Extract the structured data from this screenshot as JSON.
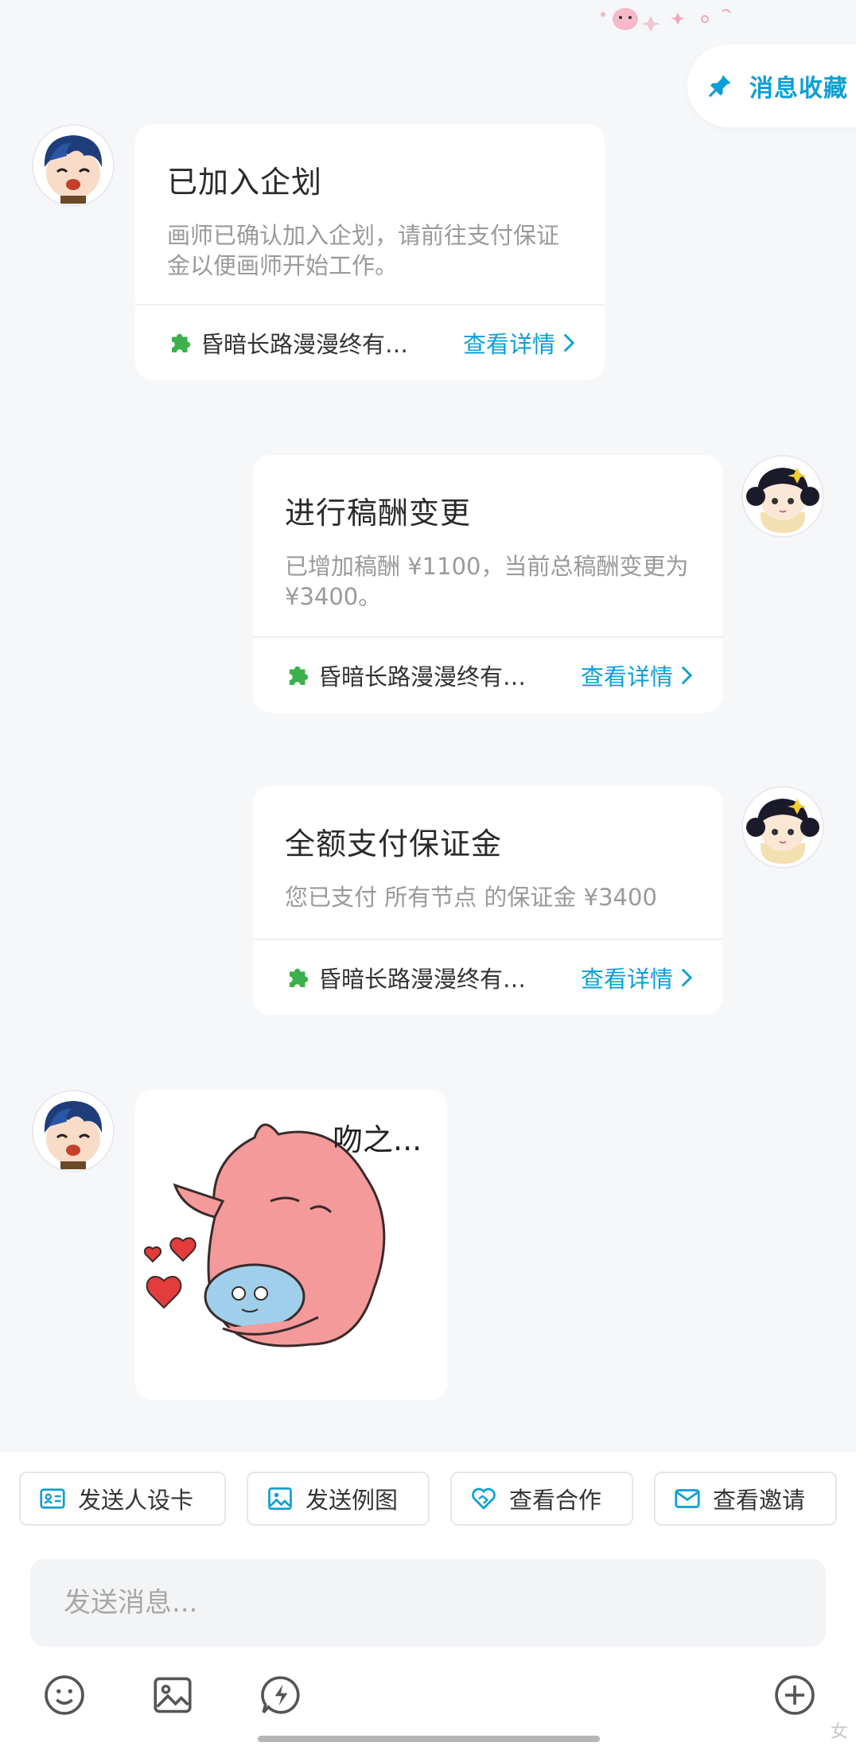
{
  "header": {
    "favorites_label": "消息收藏"
  },
  "messages": [
    {
      "title": "已加入企划",
      "desc": "画师已确认加入企划，请前往支付保证金以便画师开始工作。",
      "project": "昏暗长路漫漫终有…",
      "link": "查看详情"
    },
    {
      "title": "进行稿酬变更",
      "desc": "已增加稿酬 ¥1100，当前总稿酬变更为 ¥3400。",
      "project": "昏暗长路漫漫终有…",
      "link": "查看详情"
    },
    {
      "title": "全额支付保证金",
      "desc": "您已支付 所有节点 的保证金 ¥3400",
      "project": "昏暗长路漫漫终有…",
      "link": "查看详情"
    }
  ],
  "sticker": {
    "caption": "吻之..."
  },
  "composer": {
    "quick_actions": [
      "发送人设卡",
      "发送例图",
      "查看合作",
      "查看邀请"
    ],
    "input_placeholder": "发送消息..."
  },
  "footer": {
    "corner_text": "女"
  },
  "colors": {
    "accent": "#0a9fd6",
    "background": "#f6f7f9",
    "card": "#ffffff"
  },
  "icons": {
    "favorites": "pin-icon",
    "project": "puzzle-icon",
    "link": "chevron-right-icon",
    "quick_actions": [
      "id-card-icon",
      "image-icon",
      "heart-handshake-icon",
      "mail-icon"
    ],
    "tools": [
      "emoji-icon",
      "image-icon",
      "lightning-chat-icon",
      "plus-icon"
    ]
  }
}
